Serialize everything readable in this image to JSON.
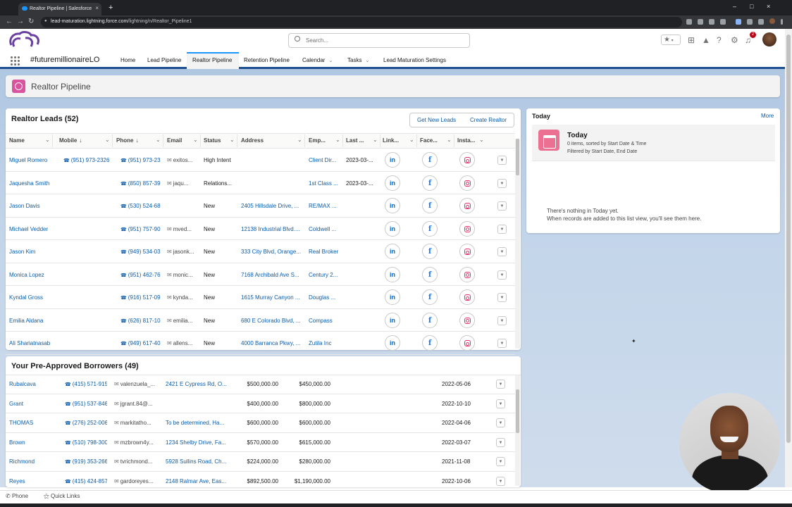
{
  "browser": {
    "tab_title": "Realtor Pipeline | Salesforce",
    "tab_close": "×",
    "new_tab": "+",
    "win_min": "–",
    "win_max": "□",
    "win_close": "×",
    "url_domain": "lead-maturation.lightning.force.com",
    "url_path": "/lightning/n/Realtor_Pipeline1",
    "back": "←",
    "forward": "→",
    "reload": "↻"
  },
  "header": {
    "search_placeholder": "Search...",
    "notification_count": "2",
    "favorites_icon": "★"
  },
  "nav": {
    "app_name": "#futuremillionaireLO",
    "items": [
      {
        "label": "Home",
        "chevron": ""
      },
      {
        "label": "Lead Pipeline",
        "chevron": ""
      },
      {
        "label": "Realtor Pipeline",
        "chevron": ""
      },
      {
        "label": "Retention Pipeline",
        "chevron": ""
      },
      {
        "label": "Calendar",
        "chevron": "⌄"
      },
      {
        "label": "Tasks",
        "chevron": "⌄"
      },
      {
        "label": "Lead Maturation Settings",
        "chevron": ""
      }
    ]
  },
  "page": {
    "title": "Realtor Pipeline"
  },
  "realtor_leads": {
    "title": "Realtor Leads (52)",
    "buttons": {
      "get_new": "Get New Leads",
      "create": "Create Realtor"
    },
    "columns": [
      {
        "label": "Name",
        "arrow": ""
      },
      {
        "label": "Mobile",
        "arrow": "↓"
      },
      {
        "label": "Phone",
        "arrow": "↓"
      },
      {
        "label": "Email",
        "arrow": ""
      },
      {
        "label": "Status",
        "arrow": ""
      },
      {
        "label": "Address",
        "arrow": ""
      },
      {
        "label": "Emp...",
        "arrow": ""
      },
      {
        "label": "Last ...",
        "arrow": ""
      },
      {
        "label": "Link...",
        "arrow": ""
      },
      {
        "label": "Face...",
        "arrow": ""
      },
      {
        "label": "Insta...",
        "arrow": ""
      }
    ],
    "col_chevron": "⌄",
    "social": {
      "linkedin": "in",
      "facebook": "f"
    },
    "rows": [
      {
        "name": "Miguel Romero",
        "mobile": "(951) 973-2326",
        "phone": "(951) 973-23...",
        "email": "exitos...",
        "status": "High Intent",
        "address": "",
        "emp": "Client Dir...",
        "last": "2023-03-..."
      },
      {
        "name": "Jaquesha Smith",
        "mobile": "",
        "phone": "(850) 857-39...",
        "email": "jaqu...",
        "status": "Relations...",
        "address": "",
        "emp": "1st Class ...",
        "last": "2023-03-..."
      },
      {
        "name": "Jason Davis",
        "mobile": "",
        "phone": "(530) 524-68...",
        "email": "",
        "status": "New",
        "address": "2405 Hillsdale Drive, ...",
        "emp": "RE/MAX ...",
        "last": ""
      },
      {
        "name": "Michael Vedder",
        "mobile": "",
        "phone": "(951) 757-90...",
        "email": "mved...",
        "status": "New",
        "address": "12138 Industrial Blvd....",
        "emp": "Coldwell ...",
        "last": ""
      },
      {
        "name": "Jason Kim",
        "mobile": "",
        "phone": "(949) 534-03...",
        "email": "jasonk...",
        "status": "New",
        "address": "333 City Blvd, Orange...",
        "emp": "Real Broker",
        "last": ""
      },
      {
        "name": "Monica Lopez",
        "mobile": "",
        "phone": "(951) 462-76...",
        "email": "monic...",
        "status": "New",
        "address": "7168 Archibald Ave S...",
        "emp": "Century 2...",
        "last": ""
      },
      {
        "name": "Kyndal Gross",
        "mobile": "",
        "phone": "(916) 517-09...",
        "email": "kynda...",
        "status": "New",
        "address": "1615 Murray Canyon ...",
        "emp": "Douglas ...",
        "last": ""
      },
      {
        "name": "Emilia Aldana",
        "mobile": "",
        "phone": "(626) 817-10...",
        "email": "emilia...",
        "status": "New",
        "address": "680 E Colorado Blvd, ...",
        "emp": "Compass",
        "last": ""
      },
      {
        "name": "Ali Shariatnasab",
        "mobile": "",
        "phone": "(949) 617-40...",
        "email": "allens...",
        "status": "New",
        "address": "4000 Barranca Pkwy, ...",
        "emp": "Zutila Inc",
        "last": ""
      }
    ],
    "row_action": "▼"
  },
  "borrowers": {
    "title": "Your Pre-Approved Borrowers (49)",
    "rows": [
      {
        "name": "Rubalcava",
        "phone": "(415) 571-915...",
        "email": "valenzuela_...",
        "address": "2421 E Cypress Rd, O...",
        "amount1": "$500,000.00",
        "amount2": "$450,000.00",
        "date": "2022-05-06"
      },
      {
        "name": "Grant",
        "phone": "(951) 537-846...",
        "email": "jgrant.84@...",
        "address": "",
        "amount1": "$400,000.00",
        "amount2": "$800,000.00",
        "date": "2022-10-10"
      },
      {
        "name": "THOMAS",
        "phone": "(276) 252-006...",
        "email": "markitatho...",
        "address": "To be determined, Ha...",
        "amount1": "$600,000.00",
        "amount2": "$600,000.00",
        "date": "2022-04-06"
      },
      {
        "name": "Brown",
        "phone": "(510) 798-300...",
        "email": "mzbrown4y...",
        "address": "1234 Shelby Drive, Fa...",
        "amount1": "$570,000.00",
        "amount2": "$615,000.00",
        "date": "2022-03-07"
      },
      {
        "name": "Richmond",
        "phone": "(919) 353-266...",
        "email": "tvrichmond...",
        "address": "5928 Sullins Road, Ch...",
        "amount1": "$224,000.00",
        "amount2": "$280,000.00",
        "date": "2021-11-08"
      },
      {
        "name": "Reyes",
        "phone": "(415) 424-857...",
        "email": "gardoreyes...",
        "address": "2148 Ralmar Ave, Eas...",
        "amount1": "$892,500.00",
        "amount2": "$1,190,000.00",
        "date": "2022-10-06"
      }
    ]
  },
  "today": {
    "label": "Today",
    "more": "More",
    "list_title": "Today",
    "sub1": "0 items, sorted by Start Date & Time",
    "sub2": "Filtered by Start Date, End Date",
    "empty1": "There's nothing in Today yet.",
    "empty2": "When records are added to this list view, you'll see them here."
  },
  "utility": {
    "phone": "Phone",
    "quick_links": "Quick Links"
  }
}
